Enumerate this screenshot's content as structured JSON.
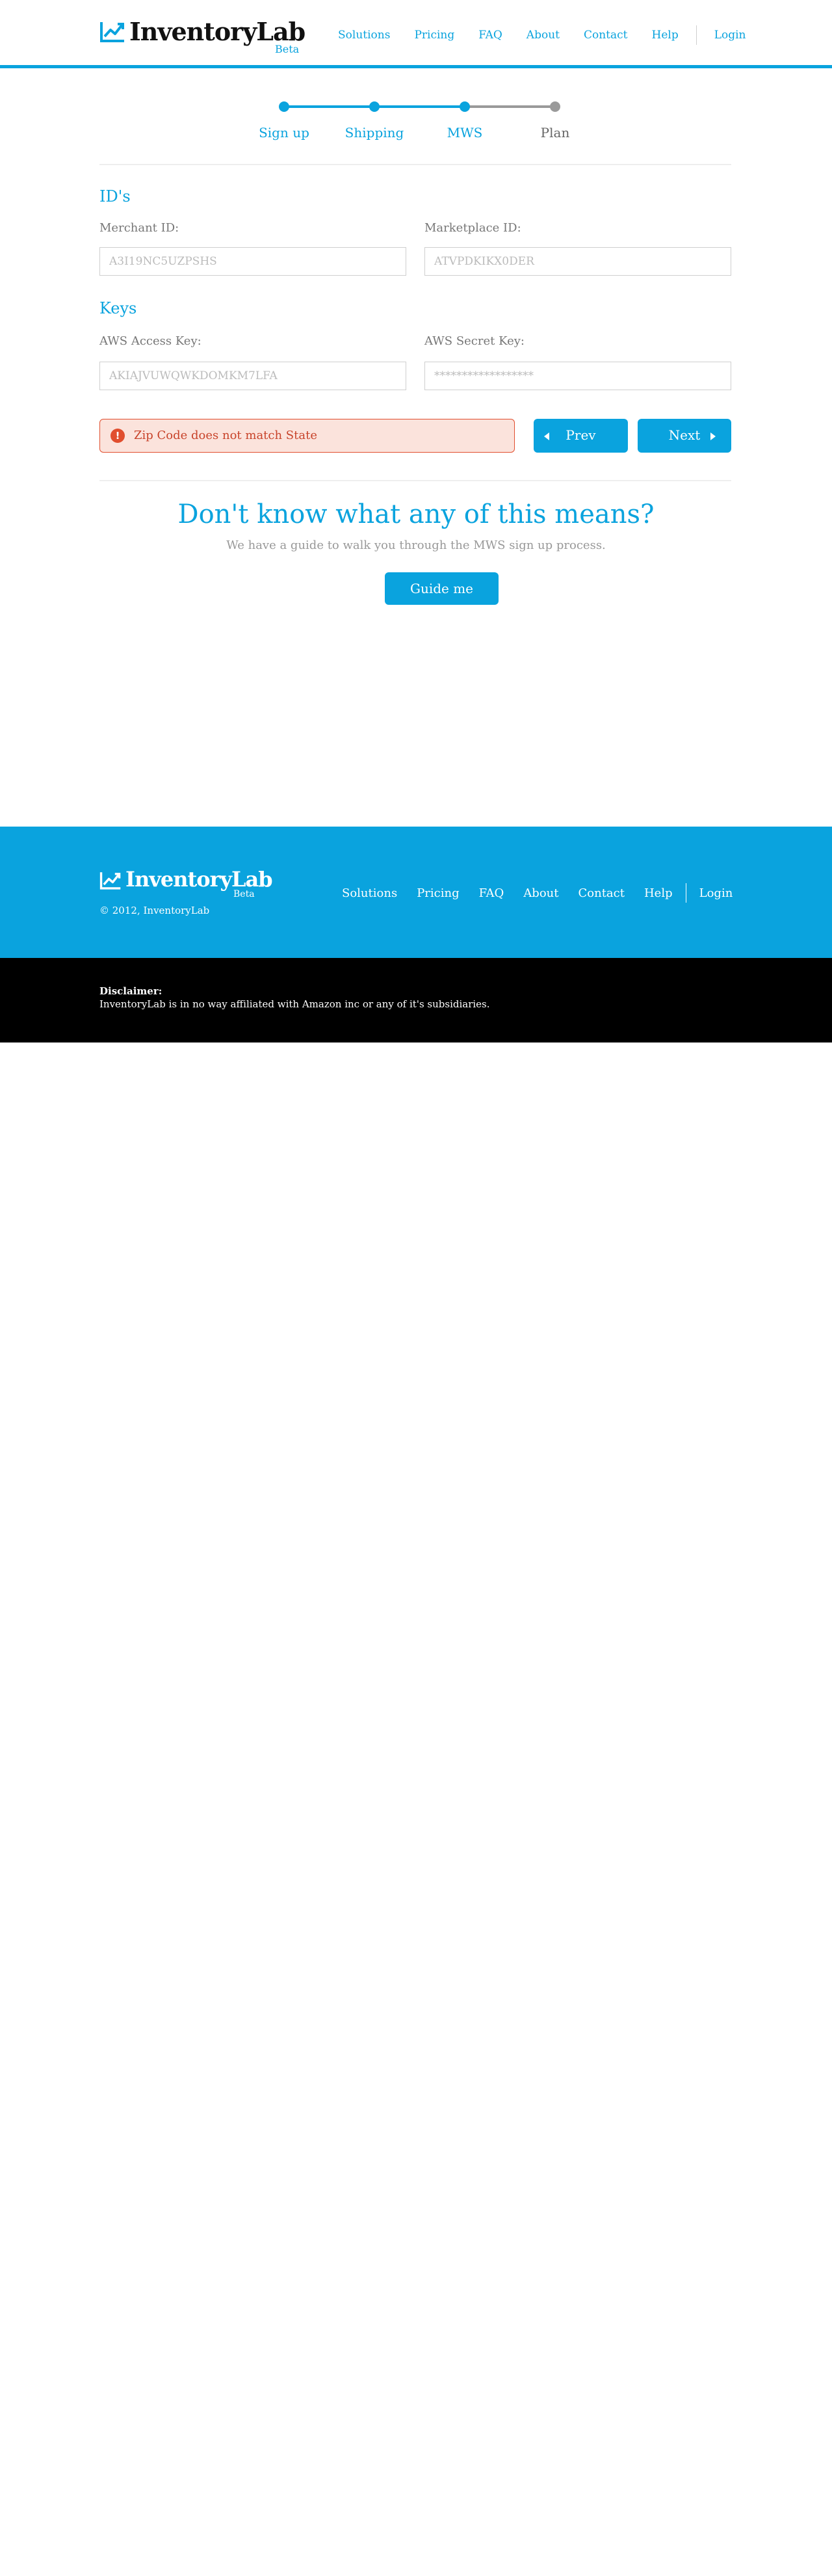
{
  "brand": {
    "name": "InventoryLab",
    "beta": "Beta",
    "accent_color": "#0aa3de"
  },
  "nav": {
    "items": [
      "Solutions",
      "Pricing",
      "FAQ",
      "About",
      "Contact",
      "Help"
    ],
    "login": "Login"
  },
  "stepper": {
    "steps": [
      {
        "label": "Sign up",
        "state": "done"
      },
      {
        "label": "Shipping",
        "state": "done"
      },
      {
        "label": "MWS",
        "state": "current"
      },
      {
        "label": "Plan",
        "state": "upcoming"
      }
    ]
  },
  "form": {
    "ids_title": "ID's",
    "merchant_label": "Merchant ID:",
    "merchant_value": "A3I19NC5UZPSHS",
    "marketplace_label": "Marketplace ID:",
    "marketplace_value": "ATVPDKIKX0DER",
    "keys_title": "Keys",
    "access_label": "AWS Access Key:",
    "access_value": "AKIAJVUWQWKDOMKM7LFA",
    "secret_label": "AWS Secret Key:",
    "secret_value": "******************"
  },
  "error": {
    "icon": "!",
    "message": "Zip Code does not match State",
    "color": "#e14e2e"
  },
  "buttons": {
    "prev": "Prev",
    "next": "Next",
    "guide": "Guide me"
  },
  "help": {
    "title": "Don't know what any of this means?",
    "subtitle": "We have a guide to walk you through the MWS sign up process."
  },
  "footer": {
    "copyright": "© 2012, InventoryLab",
    "disclaimer_title": "Disclaimer:",
    "disclaimer_text": "InventoryLab is in no way affiliated with Amazon inc or any of it's subsidiaries."
  }
}
